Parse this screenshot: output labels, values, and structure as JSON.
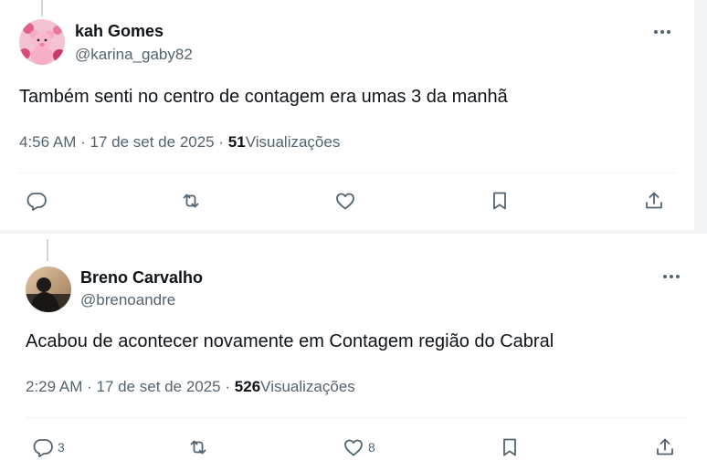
{
  "tweets": [
    {
      "name": "kah Gomes",
      "handle": "@karina_gaby82",
      "text": "Também senti no centro de contagem era umas 3 da manhã",
      "time": "4:56 AM",
      "separator": "·",
      "date": "17 de set de 2025",
      "views_count": "51",
      "views_label": "Visualizações",
      "reply_count": "",
      "like_count": "",
      "avatar_colors": [
        "#f7c8d8",
        "#d94b78"
      ]
    },
    {
      "name": "Breno Carvalho",
      "handle": "@brenoandre",
      "text": "Acabou de acontecer novamente em Contagem região do Cabral",
      "time": "2:29 AM",
      "separator": "·",
      "date": "17 de set de 2025",
      "views_count": "526",
      "views_label": "Visualizações",
      "reply_count": "3",
      "like_count": "8",
      "avatar_colors": [
        "#c9a27a",
        "#2b2521"
      ]
    }
  ],
  "icons": {
    "more": "more-dots-icon",
    "reply": "reply-icon",
    "retweet": "retweet-icon",
    "like": "heart-icon",
    "bookmark": "bookmark-icon",
    "share": "share-icon"
  },
  "colors": {
    "text": "#0f1419",
    "secondary": "#536471",
    "icon": "#536471",
    "divider": "#eff3f4",
    "background": "#ffffff"
  }
}
